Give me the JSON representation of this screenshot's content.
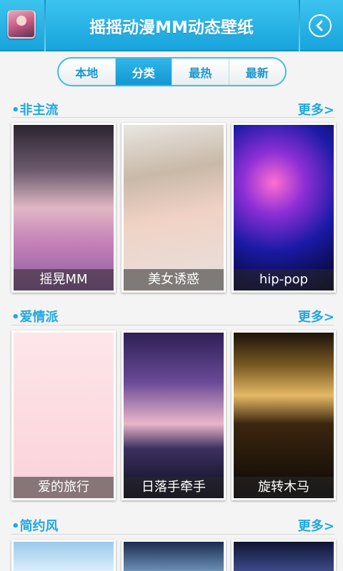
{
  "header": {
    "title": "摇摇动漫MM动态壁纸"
  },
  "tabs": [
    {
      "label": "本地",
      "active": false
    },
    {
      "label": "分类",
      "active": true
    },
    {
      "label": "最热",
      "active": false
    },
    {
      "label": "最新",
      "active": false
    }
  ],
  "sections": [
    {
      "title": "•非主流",
      "more": "更多>",
      "cards": [
        {
          "caption": "摇晃MM"
        },
        {
          "caption": "美女诱惑"
        },
        {
          "caption": "hip-pop"
        }
      ]
    },
    {
      "title": "•爱情派",
      "more": "更多>",
      "cards": [
        {
          "caption": "爱的旅行"
        },
        {
          "caption": "日落手牵手"
        },
        {
          "caption": "旋转木马"
        }
      ]
    },
    {
      "title": "•简约风",
      "more": "更多>",
      "cards": []
    }
  ],
  "colors": {
    "accent": "#21a8df",
    "header_top": "#3cc3ef",
    "header_bottom": "#18a4dc"
  },
  "icons": {
    "app_icon": "app-icon",
    "back": "back-arrow-icon"
  }
}
